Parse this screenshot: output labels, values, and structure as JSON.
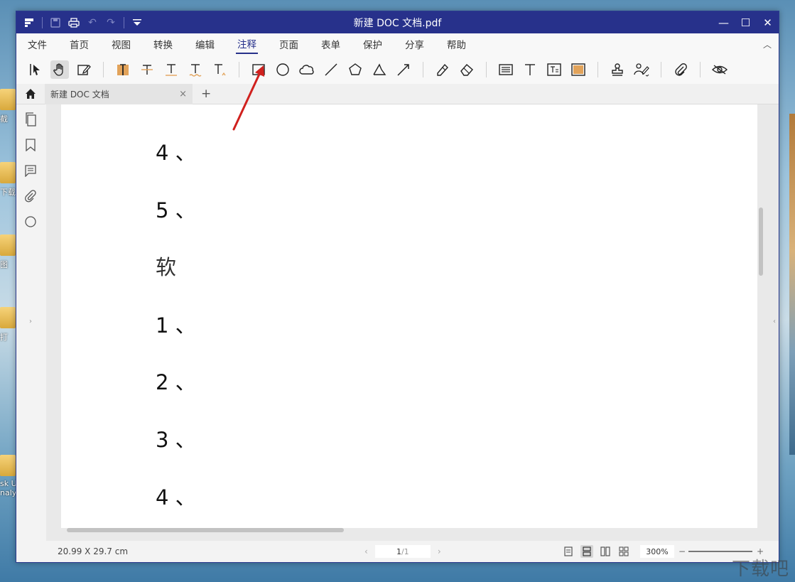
{
  "window": {
    "title": "新建 DOC 文档.pdf",
    "minimize": "—",
    "maximize": "☐",
    "close": "✕"
  },
  "menu": {
    "items": [
      "文件",
      "首页",
      "视图",
      "转换",
      "编辑",
      "注释",
      "页面",
      "表单",
      "保护",
      "分享",
      "帮助"
    ],
    "active": "注释",
    "collapse": "︿"
  },
  "tabs": {
    "doc_tab": "新建 DOC 文档",
    "close": "×",
    "add": "+"
  },
  "document": {
    "lines": [
      "4 、",
      "5 、",
      "软",
      "1 、",
      "2 、",
      "3 、",
      "4 、"
    ]
  },
  "status": {
    "page_size": "20.99 X 29.7 cm",
    "current_page": "1",
    "total_pages": "/1",
    "zoom": "300%",
    "zoom_minus": "−",
    "zoom_plus": "+",
    "prev": "‹",
    "next": "›"
  },
  "desktop": {
    "labels": [
      "截",
      "下载",
      "图",
      "打",
      "sk U",
      "naly"
    ]
  },
  "watermark": "下载吧",
  "colors": {
    "titlebar": "#27318b",
    "accent": "#27318b",
    "highlight_tool": "#e2a35a",
    "annotation_arrow": "#d0211e"
  }
}
